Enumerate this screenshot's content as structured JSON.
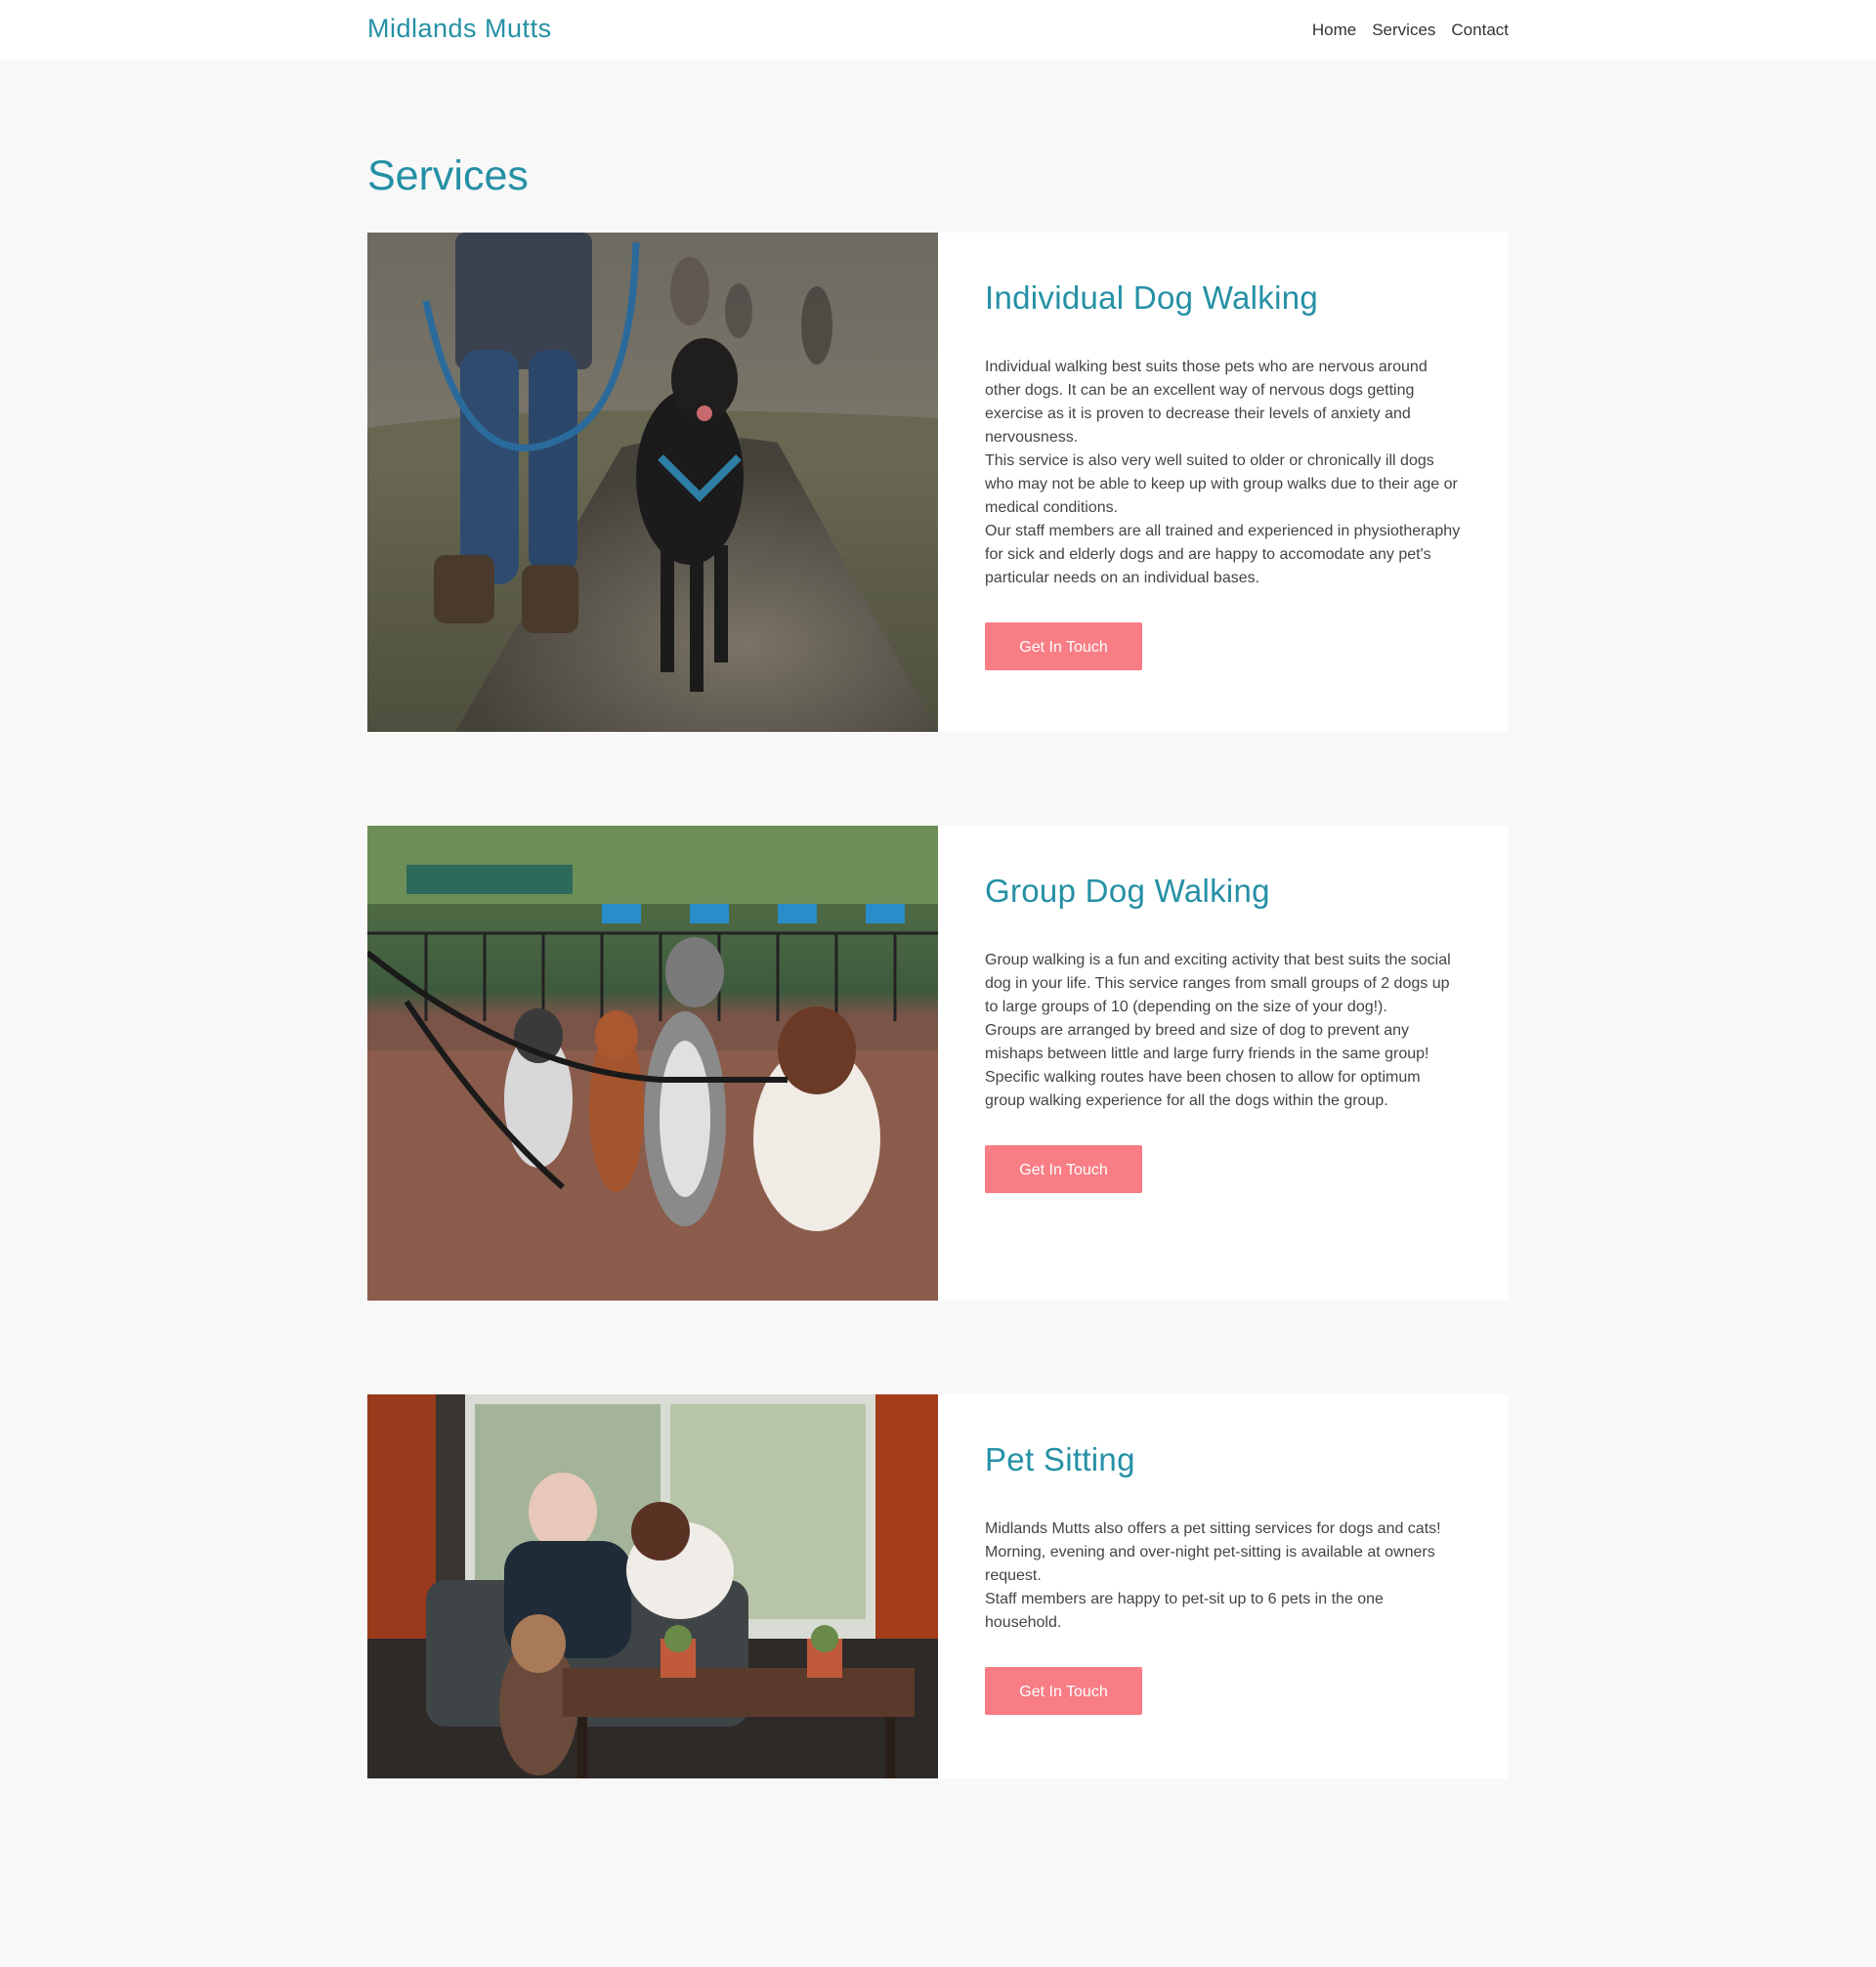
{
  "header": {
    "brand": "Midlands Mutts",
    "nav": [
      "Home",
      "Services",
      "Contact"
    ]
  },
  "page": {
    "title": "Services"
  },
  "services": [
    {
      "title": "Individual Dog Walking",
      "paragraphs": [
        "Individual walking best suits those pets who are nervous around other dogs. It can be an excellent way of nervous dogs getting exercise as it is proven to decrease their levels of anxiety and nervousness.",
        "This service is also very well suited to older or chronically ill dogs who may not be able to keep up with group walks due to their age or medical conditions.",
        "Our staff members are all trained and experienced in physiotheraphy for sick and elderly dogs and are happy to accomodate any pet's particular needs on an individual bases."
      ],
      "button": "Get In Touch"
    },
    {
      "title": "Group Dog Walking",
      "paragraphs": [
        "Group walking is a fun and exciting activity that best suits the social dog in your life. This service ranges from small groups of 2 dogs up to large groups of 10 (depending on the size of your dog!).",
        "Groups are arranged by breed and size of dog to prevent any mishaps between little and large furry friends in the same group!",
        "Specific walking routes have been chosen to allow for optimum group walking experience for all the dogs within the group."
      ],
      "button": "Get In Touch"
    },
    {
      "title": "Pet Sitting",
      "paragraphs": [
        "Midlands Mutts also offers a pet sitting services for dogs and cats!",
        "Morning, evening and over-night pet-sitting is available at owners request.",
        "Staff members are happy to pet-sit up to 6 pets in the one household."
      ],
      "button": "Get In Touch"
    }
  ],
  "colors": {
    "accent": "#2590a5",
    "button": "#f87d85",
    "background": "#f8f8f8"
  }
}
